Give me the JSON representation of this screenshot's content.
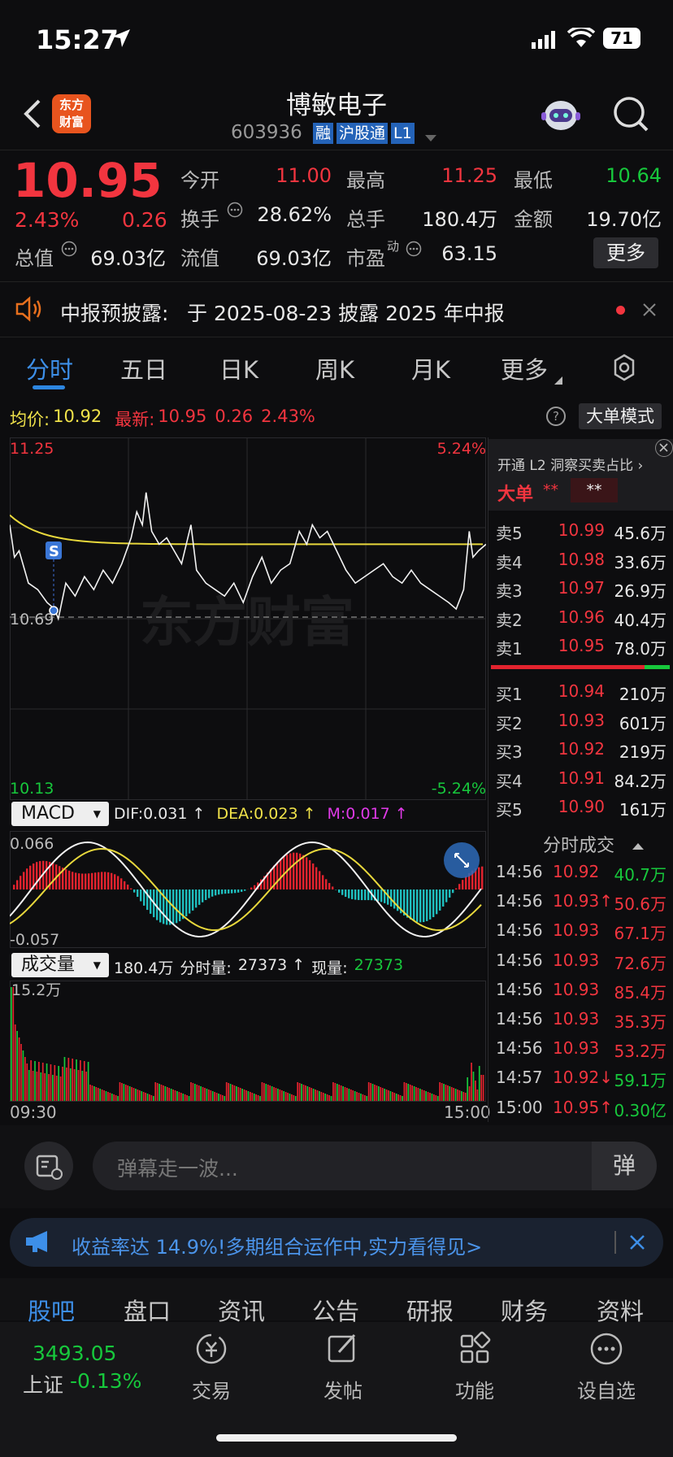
{
  "status": {
    "time": "15:27",
    "battery": "71"
  },
  "header": {
    "logo": "东方财富",
    "title": "博敏电子",
    "code": "603936",
    "tags": [
      "融",
      "沪股通",
      "L1"
    ]
  },
  "quote": {
    "price": "10.95",
    "pct": "2.43%",
    "chg": "0.26",
    "fields": [
      {
        "label": "今开",
        "value": "11.00"
      },
      {
        "label": "最高",
        "value": "11.25"
      },
      {
        "label": "最低",
        "value": "10.64"
      },
      {
        "label": "换手",
        "value": "28.62%"
      },
      {
        "label": "总手",
        "value": "180.4万"
      },
      {
        "label": "金额",
        "value": "19.70亿"
      },
      {
        "label": "总值",
        "value": "69.03亿"
      },
      {
        "label": "流值",
        "value": "69.03亿"
      },
      {
        "label": "市盈",
        "sup": "动",
        "value": "63.15"
      }
    ],
    "more": "更多"
  },
  "notice": {
    "label": "中报预披露:",
    "text": "于 2025-08-23 披露 2025 年中报"
  },
  "tabs": [
    "分时",
    "五日",
    "日K",
    "周K",
    "月K",
    "更多"
  ],
  "info": {
    "avg_label": "均价:",
    "avg": "10.92",
    "latest_label": "最新:",
    "latest": "10.95",
    "chg": "0.26",
    "pct": "2.43%",
    "mode": "大单模式"
  },
  "chart": {
    "ymax": "11.25",
    "ymin": "10.13",
    "pmax": "5.24%",
    "pmin": "-5.24%",
    "low": "10.69",
    "watermark": "东方财富",
    "marker": "S",
    "price_range": [
      10.13,
      11.25
    ],
    "avg_price": 10.92
  },
  "macd": {
    "label": "MACD",
    "dif": "DIF:0.031 ↑",
    "dea": "DEA:0.023 ↑",
    "m": "M:0.017 ↑",
    "top": "0.066",
    "bottom": "-0.057"
  },
  "vol": {
    "label": "成交量",
    "total": "180.4万",
    "fen_label": "分时量:",
    "fen": "27373 ↑",
    "now_label": "现量:",
    "now": "27373",
    "max": "15.2万",
    "t0": "09:30",
    "t1": "15:00"
  },
  "l2": {
    "banner": "开通 L2 洞察买卖占比 ›",
    "dadan": "大单",
    "stars1": "**",
    "stars2": "**"
  },
  "book": {
    "asks": [
      {
        "label": "卖5",
        "price": "10.99",
        "vol": "45.6万"
      },
      {
        "label": "卖4",
        "price": "10.98",
        "vol": "33.6万"
      },
      {
        "label": "卖3",
        "price": "10.97",
        "vol": "26.9万"
      },
      {
        "label": "卖2",
        "price": "10.96",
        "vol": "40.4万"
      },
      {
        "label": "卖1",
        "price": "10.95",
        "vol": "78.0万"
      }
    ],
    "bids": [
      {
        "label": "买1",
        "price": "10.94",
        "vol": "210万"
      },
      {
        "label": "买2",
        "price": "10.93",
        "vol": "601万"
      },
      {
        "label": "买3",
        "price": "10.92",
        "vol": "219万"
      },
      {
        "label": "买4",
        "price": "10.91",
        "vol": "84.2万"
      },
      {
        "label": "买5",
        "price": "10.90",
        "vol": "161万"
      }
    ]
  },
  "ticks": {
    "title": "分时成交",
    "rows": [
      {
        "t": "14:56",
        "p": "10.92",
        "v": "40.7万",
        "vc": "green"
      },
      {
        "t": "14:56",
        "p": "10.93↑",
        "v": "50.6万",
        "vc": "red"
      },
      {
        "t": "14:56",
        "p": "10.93",
        "v": "67.1万",
        "vc": "red"
      },
      {
        "t": "14:56",
        "p": "10.93",
        "v": "72.6万",
        "vc": "red"
      },
      {
        "t": "14:56",
        "p": "10.93",
        "v": "85.4万",
        "vc": "red"
      },
      {
        "t": "14:56",
        "p": "10.93",
        "v": "35.3万",
        "vc": "red"
      },
      {
        "t": "14:56",
        "p": "10.93",
        "v": "53.2万",
        "vc": "red"
      },
      {
        "t": "14:57",
        "p": "10.92↓",
        "v": "59.1万",
        "vc": "green"
      },
      {
        "t": "15:00",
        "p": "10.95↑",
        "v": "0.30亿",
        "vc": "green"
      }
    ]
  },
  "danmu": {
    "placeholder": "弹幕走一波...",
    "btn": "弹"
  },
  "ad": {
    "text": "收益率达 14.9%!多期组合运作中,实力看得见>"
  },
  "bottom_tabs": [
    "股吧",
    "盘口",
    "资讯",
    "公告",
    "研报",
    "财务",
    "资料"
  ],
  "index": {
    "value": "3493.05",
    "name": "上证",
    "pct": "-0.13%"
  },
  "nav": [
    "交易",
    "发帖",
    "功能",
    "设自选"
  ],
  "colors": {
    "up": "#f2353f",
    "down": "#17c83c",
    "avg": "#f0e24a",
    "accent": "#2d86e0"
  }
}
